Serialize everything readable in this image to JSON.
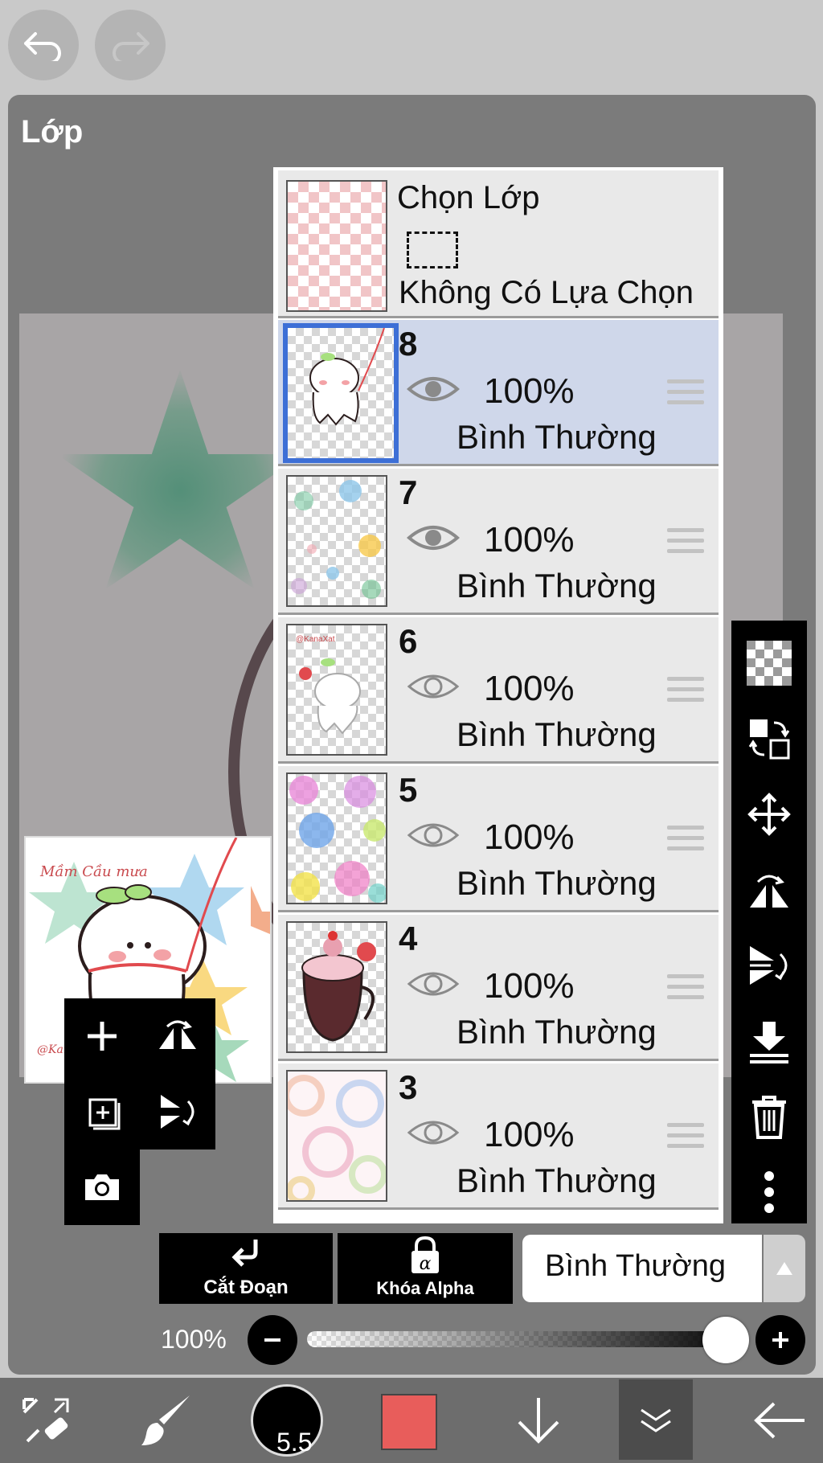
{
  "panel": {
    "title": "Lớp"
  },
  "selection_row": {
    "title": "Chọn Lớp",
    "status": "Không Có Lựa Chọn"
  },
  "layers": [
    {
      "number": "8",
      "opacity": "100%",
      "mode": "Bình Thường",
      "visible": true,
      "selected": true
    },
    {
      "number": "7",
      "opacity": "100%",
      "mode": "Bình Thường",
      "visible": true,
      "selected": false
    },
    {
      "number": "6",
      "opacity": "100%",
      "mode": "Bình Thường",
      "visible": false,
      "selected": false
    },
    {
      "number": "5",
      "opacity": "100%",
      "mode": "Bình Thường",
      "visible": false,
      "selected": false
    },
    {
      "number": "4",
      "opacity": "100%",
      "mode": "Bình Thường",
      "visible": false,
      "selected": false
    },
    {
      "number": "3",
      "opacity": "100%",
      "mode": "Bình Thường",
      "visible": false,
      "selected": false
    }
  ],
  "actions": {
    "clipping": "Cắt Đoạn",
    "alpha_lock": "Khóa Alpha",
    "blend_mode": "Bình Thường"
  },
  "opacity": {
    "label": "100%",
    "value": 1.0
  },
  "brush": {
    "size": "5.5",
    "color": "#e85d5b"
  },
  "icons": {
    "top": [
      "undo-icon",
      "redo-icon"
    ],
    "left_tools": [
      "add-layer-icon",
      "flip-horizontal-icon",
      "add-copy-layer-icon",
      "flip-vertical-icon",
      "camera-icon"
    ],
    "right_tools": [
      "transparency-icon",
      "swap-icon",
      "move-icon",
      "flip-rotate-icon",
      "flip-vertical-icon",
      "merge-down-icon",
      "trash-icon",
      "more-icon"
    ],
    "bottom": [
      "transform-icon",
      "brush-icon",
      "brush-size",
      "color-swatch",
      "arrow-down-icon",
      "layer-panel-icon",
      "back-icon"
    ]
  }
}
